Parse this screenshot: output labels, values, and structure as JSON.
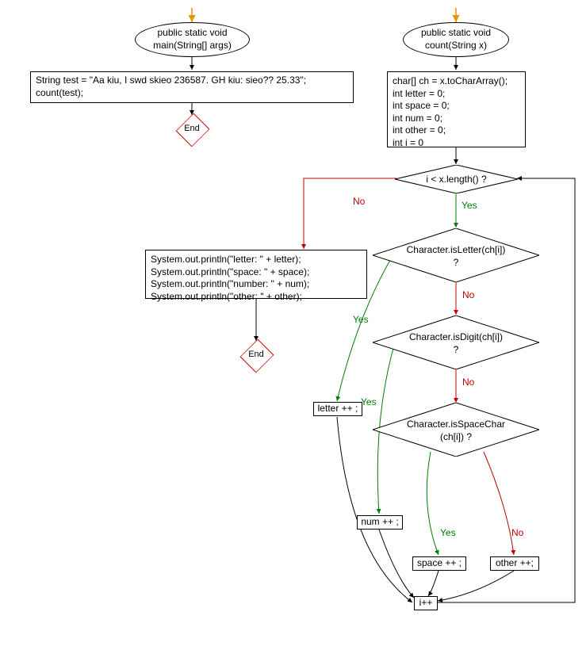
{
  "left": {
    "main_ellipse": "  public static void\nmain(String[] args)",
    "stmt_block": "String test = \"Aa kiu, I swd skieo 236587. GH kiu: sieo?? 25.33\";\ncount(test);",
    "end": "End"
  },
  "right": {
    "count_ellipse": "public static void\n  count(String x)",
    "init_block": "char[] ch = x.toCharArray();\nint letter = 0;\nint space = 0;\nint num = 0;\nint other = 0;\nint i = 0",
    "cond_loop": "i < x.length() ?",
    "print_block": "System.out.println(\"letter: \" + letter);\nSystem.out.println(\"space: \" + space);\nSystem.out.println(\"number: \" + num);\nSystem.out.println(\"other: \" + other);",
    "end": "End",
    "cond_isletter": "Character.isLetter(ch[i])\n?",
    "cond_isdigit": "Character.isDigit(ch[i])\n?",
    "cond_isspace": "Character.isSpaceChar\n(ch[i]) ?",
    "stmt_letter": "letter ++ ;",
    "stmt_num": "num ++ ;",
    "stmt_space": "space ++ ;",
    "stmt_other": "other ++;",
    "stmt_incr": "i++",
    "yes": "Yes",
    "no": "No"
  }
}
